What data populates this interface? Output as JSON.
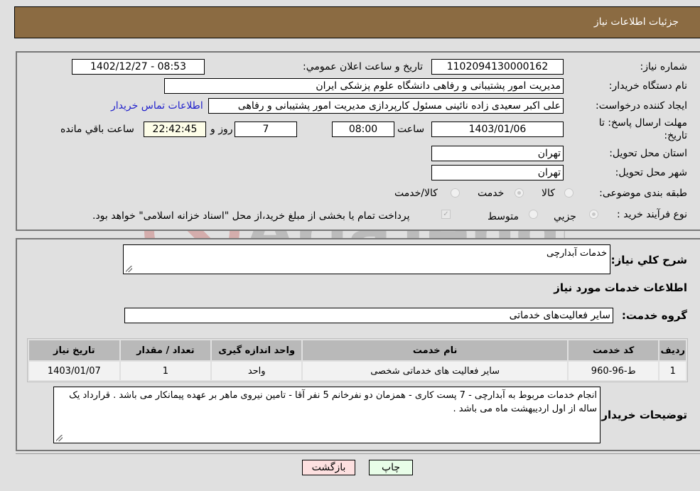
{
  "header": {
    "title": "جزئیات اطلاعات نیاز"
  },
  "form": {
    "need_number": {
      "label": "شماره نیاز:",
      "value": "1102094130000162"
    },
    "announce_datetime": {
      "label": "تاريخ و ساعت اعلان عمومي:",
      "value": "1402/12/27 - 08:53"
    },
    "buyer_org": {
      "label": "نام دستگاه خریدار:",
      "value": "مدیریت امور پشتیبانی و رفاهی دانشگاه علوم پزشکی ایران"
    },
    "requester": {
      "label": "ایجاد کننده درخواست:",
      "value": "علی اکبر سعیدی زاده نائینی مسئول کارپردازی مدیریت امور پشتیبانی و رفاهی",
      "contact_link": "اطلاعات تماس خریدار"
    },
    "deadline": {
      "label": "مهلت ارسال پاسخ: تا تاریخ:",
      "date": "1403/01/06",
      "time_label": "ساعت",
      "time": "08:00",
      "days": "7",
      "days_label": "روز و",
      "remaining": "22:42:45",
      "remaining_label": "ساعت باقي مانده"
    },
    "province": {
      "label": "استان محل تحویل:",
      "value": "تهران"
    },
    "city": {
      "label": "شهر محل تحویل:",
      "value": "تهران"
    },
    "category": {
      "label": "طبقه بندی موضوعی:",
      "options": [
        {
          "label": "کالا",
          "checked": false
        },
        {
          "label": "خدمت",
          "checked": true
        },
        {
          "label": "کالا/خدمت",
          "checked": false
        }
      ]
    },
    "purchase_type": {
      "label": "نوع فرآیند خرید :",
      "options": [
        {
          "label": "جزيي",
          "checked": true
        },
        {
          "label": "متوسط",
          "checked": false
        }
      ],
      "treasury_checkbox": {
        "label": "پرداخت تمام یا بخشی از مبلغ خرید،از محل \"اسناد خزانه اسلامی\" خواهد بود.",
        "checked": true
      }
    }
  },
  "details": {
    "summary": {
      "label": "شرح کلي نياز:",
      "value": "خدمات آبدارچی"
    },
    "services_heading": "اطلاعات خدمات مورد نياز",
    "service_group": {
      "label": "گروه خدمت:",
      "value": "سایر فعالیت‌های خدماتی"
    },
    "table": {
      "headers": [
        "رديف",
        "کد خدمت",
        "نام خدمت",
        "واحد اندازه گیری",
        "تعداد / مقدار",
        "تاريخ نياز"
      ],
      "rows": [
        [
          "1",
          "ط-96-960",
          "سایر فعالیت های خدماتی شخصی",
          "واحد",
          "1",
          "1403/01/07"
        ]
      ]
    },
    "buyer_notes": {
      "label": "توضيحات خريدار:",
      "value": "انجام خدمات مربوط به آبدارچی - 7 پست کاری - همزمان دو نفرخانم 5 نفر آقا - تامین نیروی ماهر بر عهده پیمانکار می باشد . قرارداد یک ساله از اول اردیبهشت ماه می باشد ."
    }
  },
  "buttons": {
    "print": "چاپ",
    "back": "بازگشت"
  },
  "watermark": {
    "text": "AriaTender.neT"
  }
}
